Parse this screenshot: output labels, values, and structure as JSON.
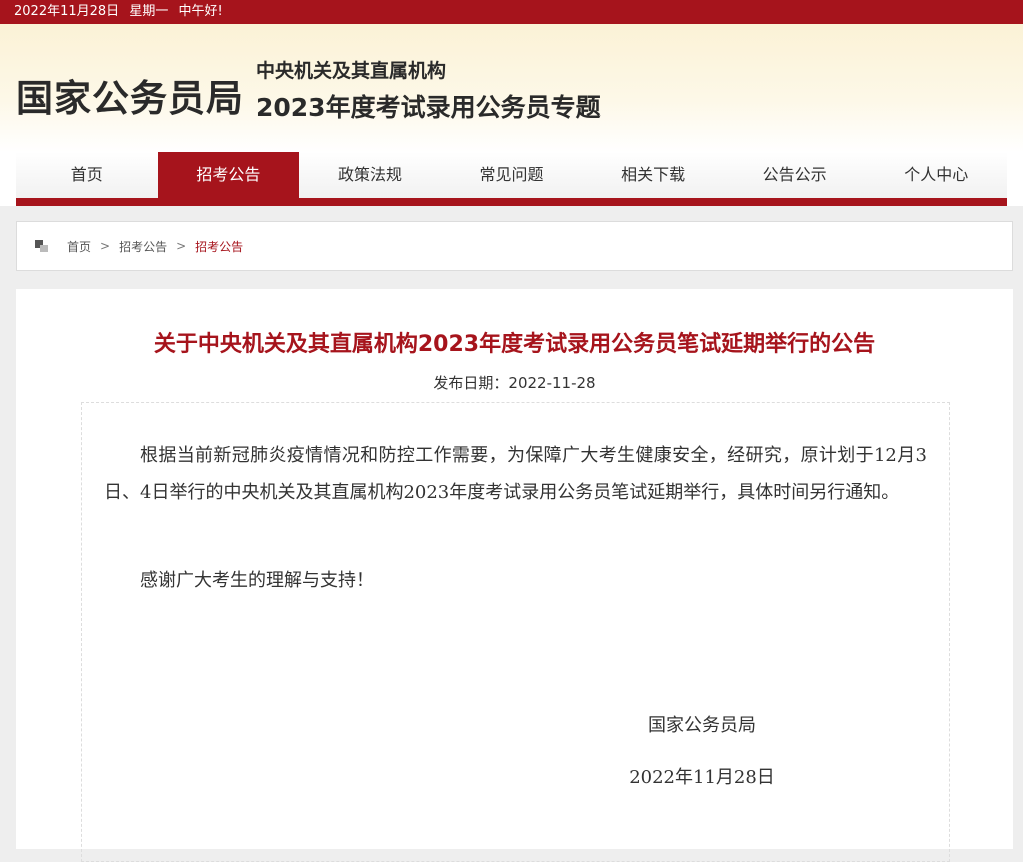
{
  "topbar": {
    "date": "2022年11月28日",
    "weekday": "星期一",
    "greeting": "中午好!"
  },
  "header": {
    "brand": "国家公务员局",
    "sub1": "中央机关及其直属机构",
    "sub2": "2023年度考试录用公务员专题"
  },
  "nav": {
    "items": [
      "首页",
      "招考公告",
      "政策法规",
      "常见问题",
      "相关下载",
      "公告公示",
      "个人中心"
    ],
    "active": "招考公告"
  },
  "breadcrumb": {
    "items": [
      "首页",
      "招考公告",
      "招考公告"
    ],
    "separator": ">"
  },
  "article": {
    "title": "关于中央机关及其直属机构2023年度考试录用公务员笔试延期举行的公告",
    "pub_date": "发布日期：2022-11-28",
    "paragraphs": [
      "根据当前新冠肺炎疫情情况和防控工作需要，为保障广大考生健康安全，经研究，原计划于12月3日、4日举行的中央机关及其直属机构2023年度考试录用公务员笔试延期举行，具体时间另行通知。",
      "感谢广大考生的理解与支持！"
    ],
    "signature_org": "国家公务员局",
    "signature_date": "2022年11月28日"
  },
  "colors": {
    "brand_red": "#a6141c",
    "title_red": "#a6141c"
  },
  "icons": {
    "breadcrumb": "location-squares-icon"
  }
}
